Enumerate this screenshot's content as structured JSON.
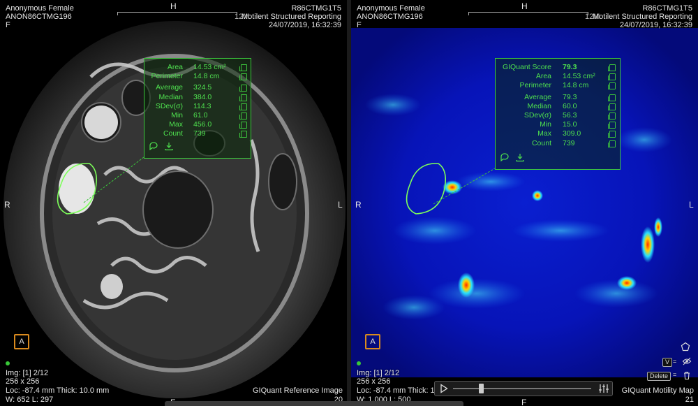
{
  "left_view": {
    "patient": "Anonymous Female",
    "patient_id": "ANON86CTMG196",
    "sex": "F",
    "series_code": "R86CTMG1T5",
    "report_title": "Motilent Structured Reporting",
    "overlap_text": "12M",
    "datetime": "24/07/2019, 16:32:39",
    "orient_top": "H",
    "orient_left": "R",
    "orient_right": "L",
    "orient_bottom": "F",
    "img_index": "Img: [1] 2/12",
    "matrix": "256 x 256",
    "location": "Loc: -87.4 mm Thick: 10.0 mm",
    "window": "W: 652 L: 297",
    "image_label": "GIQuant Reference Image",
    "frame_number": "20",
    "anno_button": "A"
  },
  "right_view": {
    "patient": "Anonymous Female",
    "patient_id": "ANON86CTMG196",
    "sex": "F",
    "series_code": "R86CTMG1T5",
    "report_title": "Motilent Structured Reporting",
    "overlap_text": "12M",
    "datetime": "24/07/2019, 16:32:39",
    "orient_top": "H",
    "orient_left": "R",
    "orient_right": "L",
    "orient_bottom": "F",
    "img_index": "Img: [1] 2/12",
    "matrix": "256 x 256",
    "location": "Loc: -87.4 mm Thick: 10.0 mm",
    "window": "W: 1,000 L: 500",
    "image_label": "GIQuant Motility Map",
    "frame_number": "21",
    "anno_button": "A",
    "key_v": "V",
    "key_delete": "Delete",
    "eq1": "=",
    "eq2": "="
  },
  "left_panel": {
    "rows": [
      {
        "label": "Area",
        "value": "14.53 cm²"
      },
      {
        "label": "Perimeter",
        "value": "14.8 cm"
      },
      {
        "label": "Average",
        "value": "324.5"
      },
      {
        "label": "Median",
        "value": "384.0"
      },
      {
        "label": "SDev(σ)",
        "value": "114.3"
      },
      {
        "label": "Min",
        "value": "61.0"
      },
      {
        "label": "Max",
        "value": "456.0"
      },
      {
        "label": "Count",
        "value": "739"
      }
    ]
  },
  "right_panel": {
    "rows": [
      {
        "label": "GIQuant Score",
        "value": "79.3"
      },
      {
        "label": "Area",
        "value": "14.53 cm²"
      },
      {
        "label": "Perimeter",
        "value": "14.8 cm"
      },
      {
        "label": "Average",
        "value": "79.3"
      },
      {
        "label": "Median",
        "value": "60.0"
      },
      {
        "label": "SDev(σ)",
        "value": "56.3"
      },
      {
        "label": "Min",
        "value": "15.0"
      },
      {
        "label": "Max",
        "value": "309.0"
      },
      {
        "label": "Count",
        "value": "739"
      }
    ]
  },
  "player": {
    "progress": 0.2
  },
  "icons": {
    "copy": "copy-icon",
    "comment": "comment-icon",
    "download": "download-icon",
    "play": "play-icon",
    "settings": "sliders-icon",
    "pentagon": "pentagon-icon",
    "hide": "eye-slash-icon",
    "trash": "trash-icon"
  },
  "colors": {
    "roi_green": "#7dff5a",
    "panel_green": "#4ee04e",
    "anno_orange": "#d98a1e"
  }
}
